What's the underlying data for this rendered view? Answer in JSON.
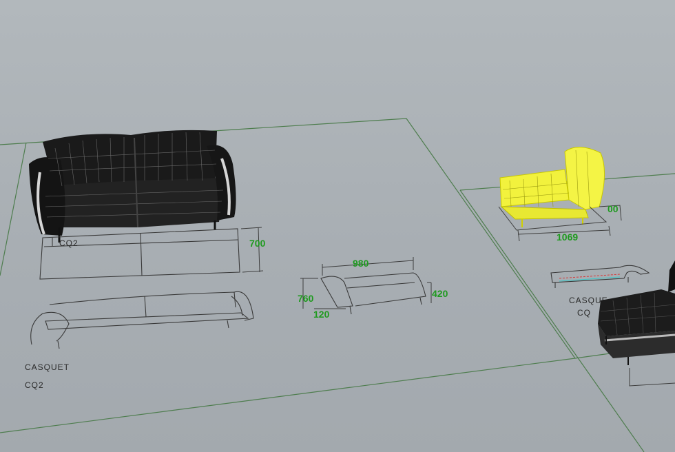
{
  "viewport": {
    "background": "#a9afb4",
    "grid_color": "#4e7d4e",
    "dimension_color": "#1f9a1f",
    "selection_color": "#f0f03a"
  },
  "dimensions": {
    "sofa_depth": "700",
    "side_width": "980",
    "side_height": "760",
    "side_seat_height": "420",
    "side_leg": "120",
    "chaise_width": "1069",
    "chaise_partial": "00"
  },
  "labels": {
    "model_name": "CASQUET",
    "model_code": "CQ2",
    "plan_code": "CQ2",
    "right_model_name": "CASQUE",
    "right_model_code": "CQ"
  }
}
